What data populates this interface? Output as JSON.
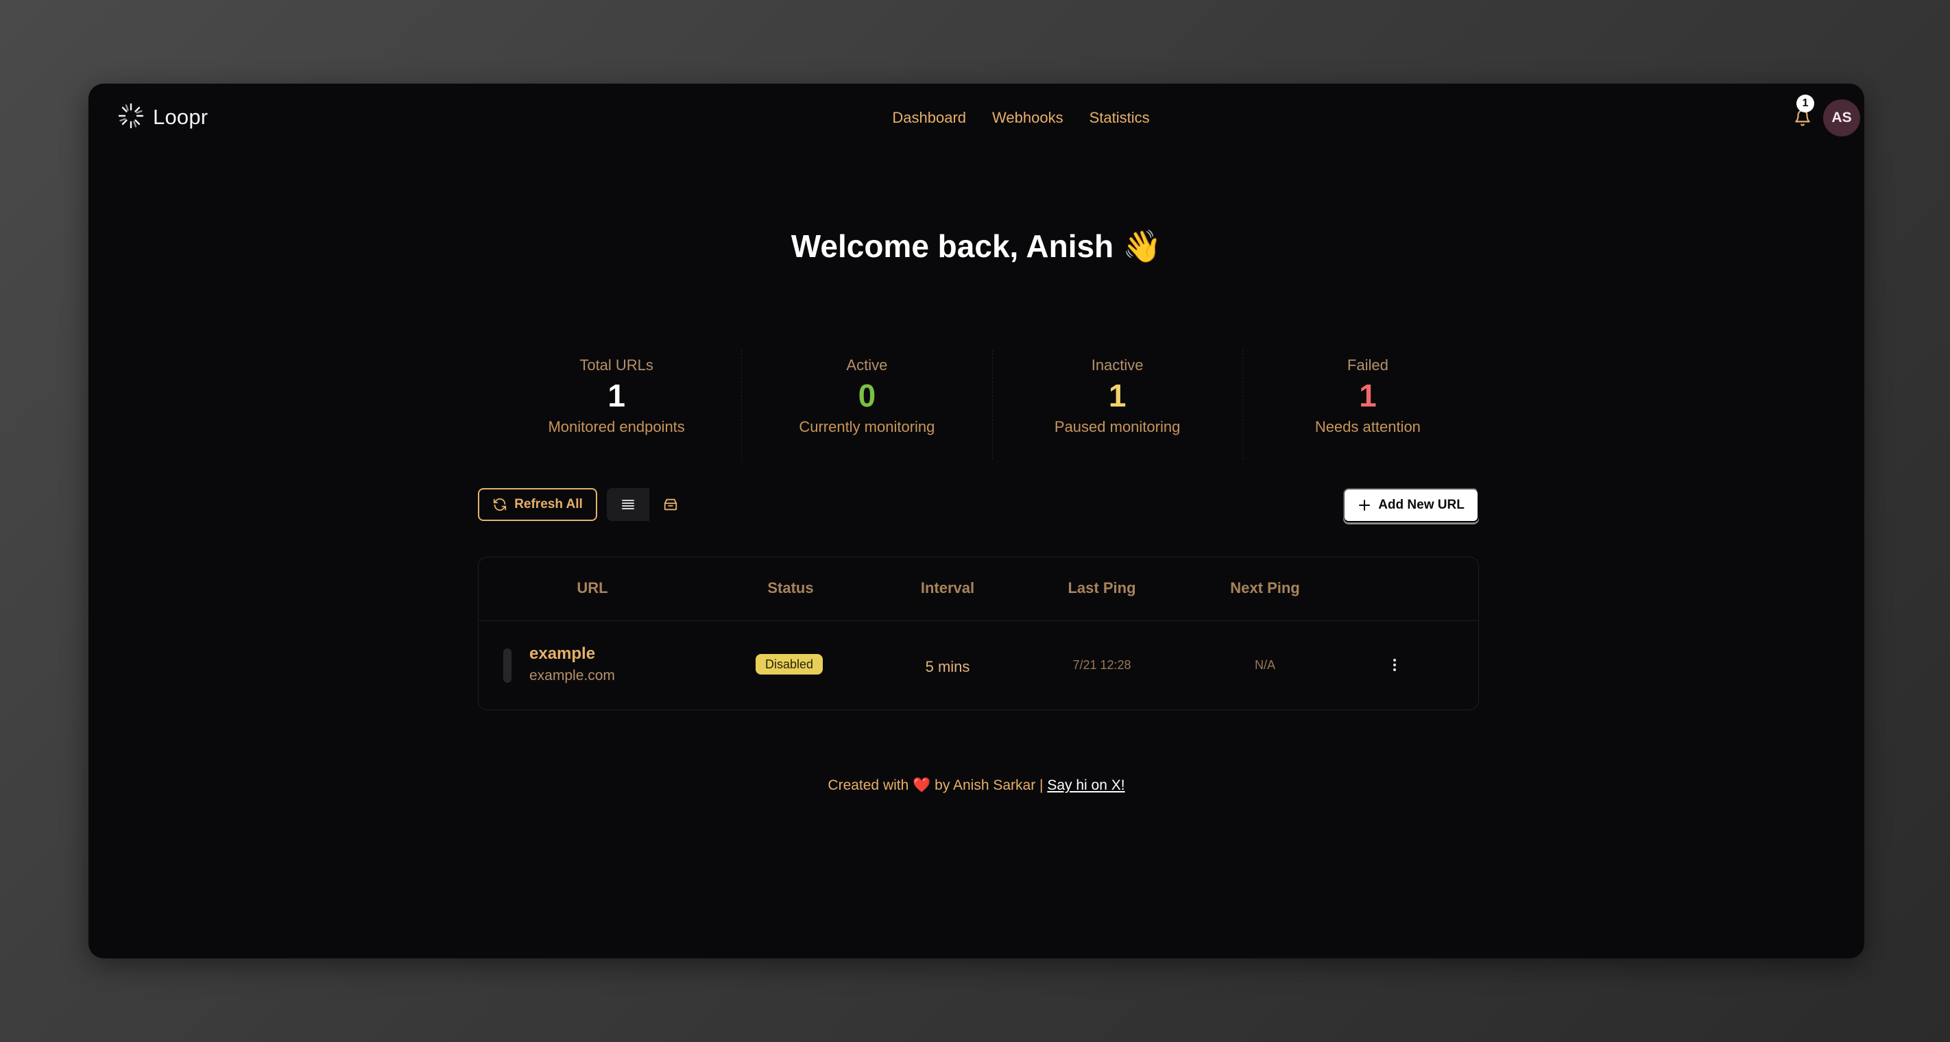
{
  "header": {
    "brand": "Loopr",
    "nav": [
      "Dashboard",
      "Webhooks",
      "Statistics"
    ],
    "notification_count": "1",
    "avatar_initials": "AS"
  },
  "welcome": "Welcome back, Anish 👋",
  "stats": [
    {
      "label": "Total URLs",
      "value": "1",
      "sub": "Monitored endpoints",
      "color": "#ffffff"
    },
    {
      "label": "Active",
      "value": "0",
      "sub": "Currently monitoring",
      "color": "#7bc043"
    },
    {
      "label": "Inactive",
      "value": "1",
      "sub": "Paused monitoring",
      "color": "#f2d06b"
    },
    {
      "label": "Failed",
      "value": "1",
      "sub": "Needs attention",
      "color": "#f06a6a"
    }
  ],
  "toolbar": {
    "refresh_label": "Refresh All",
    "add_label": "Add New URL"
  },
  "table": {
    "columns": [
      "URL",
      "Status",
      "Interval",
      "Last Ping",
      "Next Ping"
    ],
    "rows": [
      {
        "name": "example",
        "domain": "example.com",
        "status": "Disabled",
        "interval": "5 mins",
        "last_ping": "7/21 12:28",
        "next_ping": "N/A"
      }
    ]
  },
  "footer": {
    "prefix": "Created with",
    "heart": "❤️",
    "middle": "by Anish Sarkar |",
    "link": "Say hi on X!"
  },
  "colors": {
    "accent": "#e8b06a",
    "background": "#09090b",
    "status_disabled": "#e7cf5a"
  }
}
